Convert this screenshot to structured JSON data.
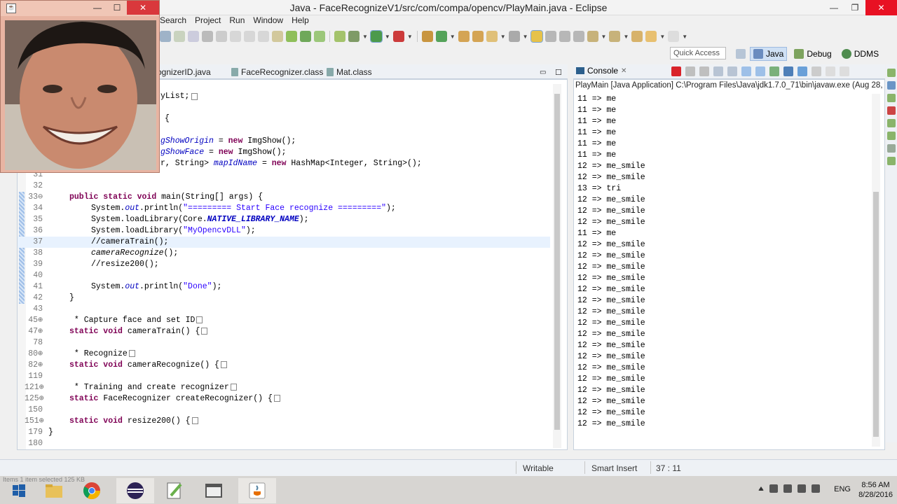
{
  "window": {
    "title": "Java - FaceRecognizeV1/src/com/compa/opencv/PlayMain.java - Eclipse",
    "minimize": "—",
    "restore": "❐",
    "close": "✕"
  },
  "menubar": [
    "Search",
    "Project",
    "Run",
    "Window",
    "Help"
  ],
  "quick_access": "Quick Access",
  "perspectives": [
    {
      "label": "Java",
      "active": true
    },
    {
      "label": "Debug",
      "active": false
    },
    {
      "label": "DDMS",
      "active": false
    }
  ],
  "webcam": {
    "min": "—",
    "max": "☐",
    "close": "✕"
  },
  "editor": {
    "tabs": [
      "ognizerID.java",
      "FaceRecognizer.class",
      "Mat.class"
    ],
    "line_numbers": [
      "31",
      "32",
      "33⊖",
      "34",
      "35",
      "36",
      "37",
      "38",
      "39",
      "40",
      "41",
      "42",
      "43",
      "45⊕",
      "47⊕",
      "78",
      "80⊕",
      "82⊕",
      "119",
      "121⊕",
      "125⊕",
      "150",
      "151⊕",
      "179",
      "180"
    ],
    "frag_lines": {
      "l1": "yList;",
      "l2": "{",
      "l3a": "gShowOrigin",
      "l3b": " = ",
      "l3c": "new",
      "l3d": " ImgShow();",
      "l4a": "gShowFace",
      "l4b": " = ",
      "l4c": "new",
      "l4d": " ImgShow();",
      "l5a": "r, String> ",
      "l5b": "mapIdName",
      "l5c": " = ",
      "l5d": "new",
      "l5e": " HashMap<Integer, String>();"
    },
    "code": {
      "main_sig_kw": "public static void",
      "main_sig_rest": " main(String[] args) {",
      "println1_pre": "System.",
      "println1_out": "out",
      "println1_mid": ".println(",
      "println1_str": "\"========= Start Face recognize =========\"",
      "println1_end": ");",
      "load1_pre": "System.loadLibrary(Core.",
      "load1_const": "NATIVE_LIBRARY_NAME",
      "load1_end": ");",
      "load2_pre": "System.loadLibrary(",
      "load2_str": "\"MyOpencvDLL\"",
      "load2_end": ");",
      "c37": "//cameraTrain();",
      "c38": "cameraRecognize",
      "c38_end": "();",
      "c39": "//resize200();",
      "println2_pre": "System.",
      "println2_out": "out",
      "println2_mid": ".println(",
      "println2_str": "\"Done\"",
      "println2_end": ");",
      "close_brace": "}",
      "j45": " * Capture face and set ID",
      "s47_kw": "static void",
      "s47_rest": " cameraTrain() {",
      "j80": " * Recognize",
      "s82_kw": "static void",
      "s82_rest": " cameraRecognize() {",
      "j121": " * Training and create recognizer",
      "s125_kw": "static",
      "s125_rest": " FaceRecognizer createRecognizer() {",
      "s151_kw": "static void",
      "s151_rest": " resize200() {",
      "class_close": "}"
    }
  },
  "console": {
    "tab": "Console",
    "description": "PlayMain [Java Application] C:\\Program Files\\Java\\jdk1.7.0_71\\bin\\javaw.exe (Aug 28, 20",
    "output": [
      "11 => me",
      "11 => me",
      "11 => me",
      "11 => me",
      "11 => me",
      "11 => me",
      "12 => me_smile",
      "12 => me_smile",
      "13 => tri",
      "12 => me_smile",
      "12 => me_smile",
      "12 => me_smile",
      "11 => me",
      "12 => me_smile",
      "12 => me_smile",
      "12 => me_smile",
      "12 => me_smile",
      "12 => me_smile",
      "12 => me_smile",
      "12 => me_smile",
      "12 => me_smile",
      "12 => me_smile",
      "12 => me_smile",
      "12 => me_smile",
      "12 => me_smile",
      "12 => me_smile",
      "12 => me_smile",
      "12 => me_smile",
      "12 => me_smile",
      "12 => me_smile"
    ]
  },
  "statusbar": {
    "writable": "Writable",
    "insert_mode": "Smart Insert",
    "position": "37 : 11"
  },
  "taskbar": {
    "lang": "ENG",
    "time": "8:56 AM",
    "date": "8/28/2016",
    "faint": "Items    1 item selected  125 KB"
  }
}
